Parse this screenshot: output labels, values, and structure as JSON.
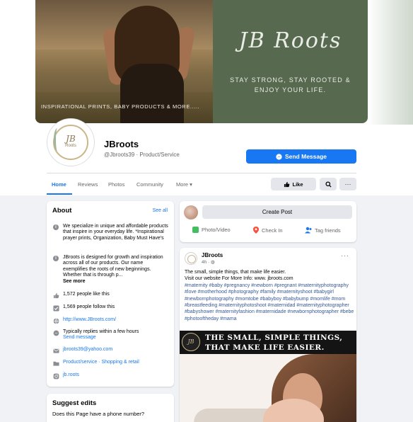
{
  "colors": {
    "accent": "#1877f2",
    "brand_green": "#57694f",
    "page_bg": "#f0f2f5"
  },
  "cover": {
    "caption": "INSPIRATIONAL PRINTS, BABY PRODUCTS & MORE.....",
    "brand_script": "JB Roots",
    "tagline_line1": "STAY STRONG, STAY ROOTED &",
    "tagline_line2": "ENJOY YOUR LIFE."
  },
  "avatar": {
    "logo_initials": "JB",
    "logo_word": "Roots"
  },
  "header": {
    "page_name": "JBroots",
    "handle_category": "@Jbroots39 · Product/Service",
    "send_message_label": "Send Message"
  },
  "tabs": [
    "Home",
    "Reviews",
    "Photos",
    "Community",
    "More ▾"
  ],
  "actions": {
    "like_label": "Like",
    "search_icon": "magnifier",
    "more_icon": "ellipsis"
  },
  "about": {
    "title": "About",
    "see_all": "See all",
    "description": "We specialize in unique and affordable products that inspire in your everyday life. *Inspirational prayer prints, Organization, Baby Must Have's",
    "story": "JBroots is designed for growth and inspiration across all of our products. Our name exemplifies the roots of new beginnings. Whether that is through p...",
    "see_more": "See more",
    "likes": "1,572 people like this",
    "follows": "1,569 people follow this",
    "website": "http://www.JBroots.com/",
    "response": "Typically replies within a few hours",
    "send_message": "Send message",
    "email": "jbroots39@yahoo.com",
    "category": "Product/service · Shopping & retail",
    "instagram": "jb.roots"
  },
  "suggest": {
    "title": "Suggest edits",
    "question": "Does this Page have a phone number?"
  },
  "create_post": {
    "button": "Create Post",
    "photo_video": "Photo/Video",
    "check_in": "Check In",
    "tag_friends": "Tag friends"
  },
  "post": {
    "author": "JBroots",
    "time": "4h · ",
    "more": "···",
    "text_line1": "The small, simple things, that make life easier.",
    "text_line2": "Visit our website For More Info: www. jbroots.com",
    "hashtags": "#maternity #baby #pregnancy #newborn #pregnant #maternityphotography #love #motherhood #photography #family #maternityshoot #babygirl #newbornphotography #momtobe #babyboy #babybump #momlife #mom #breastfeeding #maternityphotoshoot #maternidad #maternityphotographer #babyshower #maternityfashion #maternidade #newbornphotographer #bebe #photooftheday #mama",
    "image_line1": "THE SMALL, SIMPLE THINGS,",
    "image_line2": "THAT MAKE LIFE EASIER.",
    "image_logo": "JB"
  }
}
